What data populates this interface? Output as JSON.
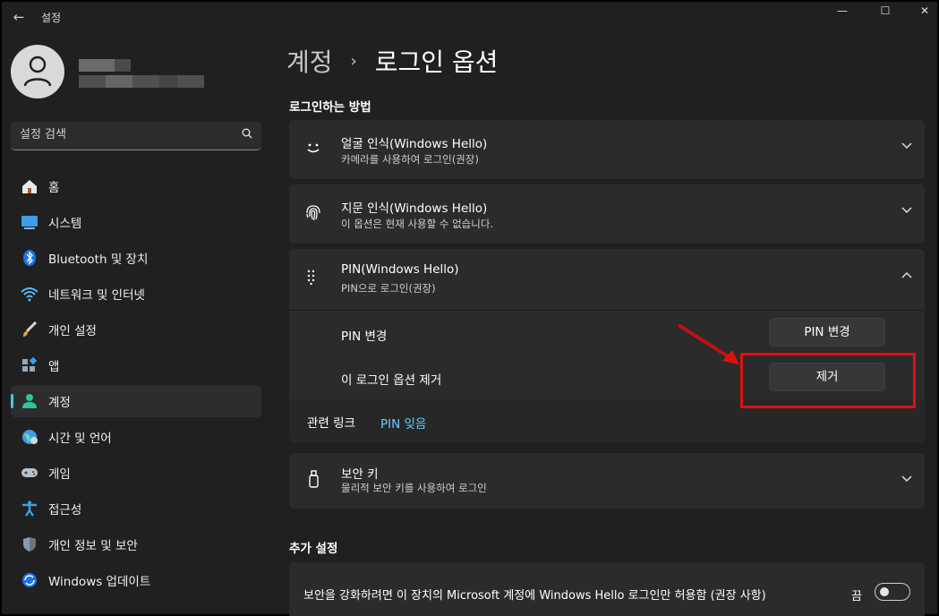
{
  "window": {
    "title": "설정",
    "back_icon": "back-arrow-icon",
    "minimize_icon": "minimize-icon",
    "maximize_icon": "maximize-icon",
    "close_icon": "close-icon"
  },
  "search": {
    "placeholder": "설정 검색",
    "icon": "search-icon"
  },
  "sidebar": {
    "items": [
      {
        "label": "홈",
        "icon": "home-icon"
      },
      {
        "label": "시스템",
        "icon": "system-icon"
      },
      {
        "label": "Bluetooth 및 장치",
        "icon": "bluetooth-icon"
      },
      {
        "label": "네트워크 및 인터넷",
        "icon": "wifi-icon"
      },
      {
        "label": "개인 설정",
        "icon": "brush-icon"
      },
      {
        "label": "앱",
        "icon": "apps-icon"
      },
      {
        "label": "계정",
        "icon": "account-icon",
        "active": true
      },
      {
        "label": "시간 및 언어",
        "icon": "globe-icon"
      },
      {
        "label": "게임",
        "icon": "gamepad-icon"
      },
      {
        "label": "접근성",
        "icon": "accessibility-icon"
      },
      {
        "label": "개인 정보 및 보안",
        "icon": "shield-icon"
      },
      {
        "label": "Windows 업데이트",
        "icon": "update-icon"
      }
    ]
  },
  "header": {
    "parent": "계정",
    "separator": "›",
    "current": "로그인 옵션"
  },
  "signin_section": {
    "title": "로그인하는 방법",
    "options": [
      {
        "title": "얼굴 인식(Windows Hello)",
        "desc": "카메라를 사용하여 로그인(권장)",
        "icon": "face-icon",
        "expanded": false
      },
      {
        "title": "지문 인식(Windows Hello)",
        "desc": "이 옵션은 현재 사용할 수 없습니다.",
        "icon": "fingerprint-icon",
        "expanded": false
      },
      {
        "title": "PIN(Windows Hello)",
        "desc": "PIN으로 로그인(권장)",
        "icon": "pin-keypad-icon",
        "expanded": true
      },
      {
        "title": "보안 키",
        "desc": "물리적 보안 키를 사용하여 로그인",
        "icon": "usb-key-icon",
        "expanded": false
      }
    ],
    "pin": {
      "change_label": "PIN 변경",
      "change_button": "PIN 변경",
      "remove_label": "이 로그인 옵션 제거",
      "remove_button": "제거",
      "related_label": "관련 링크",
      "related_link": "PIN 잊음"
    }
  },
  "additional": {
    "title": "추가 설정",
    "hello_only": {
      "label": "보안을 강화하려면 이 장치의 Microsoft 계정에 Windows Hello 로그인만 허용함 (권장 사항)",
      "state": "끔",
      "on": false
    }
  },
  "annotation_color": "#e01010",
  "accent": "#4cc2ff",
  "link_color": "#60cdff"
}
